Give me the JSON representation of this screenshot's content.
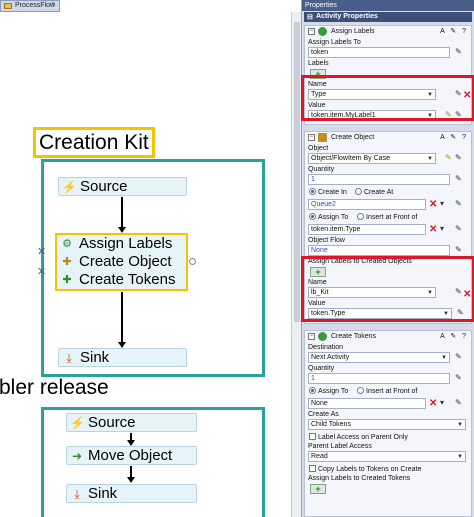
{
  "left_panel": {
    "tab_label": "ProcessFlow",
    "title_creation_kit": "Creation Kit",
    "title_release": "bler release",
    "flow1": {
      "source": "Source",
      "assign_labels": "Assign Labels",
      "create_object": "Create Object",
      "create_tokens": "Create Tokens",
      "sink": "Sink"
    },
    "flow2": {
      "source": "Source",
      "move_object": "Move Object",
      "sink": "Sink"
    }
  },
  "right_panel": {
    "header": "Properties",
    "section": "Activity Properties",
    "assign_labels_panel": {
      "title": "Assign Labels",
      "assign_to_label": "Assign Labels To",
      "assign_to_value": "token",
      "labels_label": "Labels",
      "name_label": "Name",
      "name_value": "Type",
      "value_label": "Value",
      "value_value": "token.item.MyLabel1"
    },
    "create_object_panel": {
      "title": "Create Object",
      "object_label": "Object",
      "object_value": "Object/FlowItem By Case",
      "quantity_label": "Quantity",
      "quantity_value": "1",
      "create_in": "Create In",
      "create_at": "Create At",
      "location_value": "Queue2",
      "assign_to": "Assign To",
      "insert_front": "Insert at Front of",
      "assign_value": "token.item.Type",
      "object_flow_label": "Object Flow",
      "object_flow_value": "None",
      "assign_created_label": "Assign Labels to Created Objects",
      "name_label": "Name",
      "name_value": "lb_Kit",
      "value_label": "Value",
      "value_value": "token.Type"
    },
    "create_tokens_panel": {
      "title": "Create Tokens",
      "destination_label": "Destination",
      "destination_value": "Next Activity",
      "quantity_label": "Quantity",
      "quantity_value": "1",
      "assign_to": "Assign To",
      "insert_front": "Insert at Front of",
      "assign_value": "None",
      "create_as_label": "Create As",
      "create_as_value": "Child Tokens",
      "label_access_check": "Label Access on Parent Only",
      "parent_access_label": "Parent Label Access",
      "parent_access_value": "Read",
      "copy_labels_check": "Copy Labels to Tokens on Create",
      "assign_created_label": "Assign Labels to Created Tokens"
    }
  },
  "colors": {
    "highlight_yellow": "#f5c400",
    "container_teal": "#2aa29a",
    "callout_red": "#d9182b",
    "node_fill": "#e6f4fa",
    "header_navy": "#3b4f79"
  }
}
